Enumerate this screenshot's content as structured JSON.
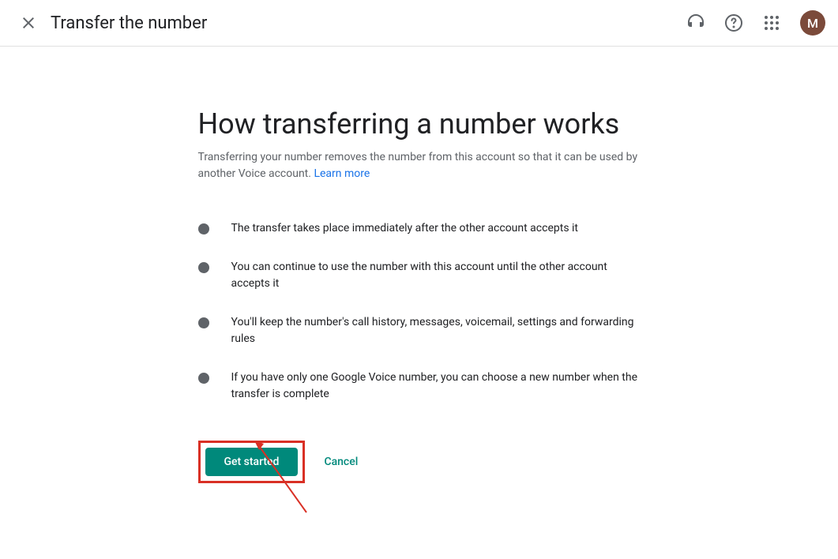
{
  "header": {
    "title": "Transfer the number",
    "avatar_letter": "M"
  },
  "main": {
    "heading": "How transferring a number works",
    "description": "Transferring your number removes the number from this account so that it can be used by another Voice account. ",
    "learn_more": "Learn more",
    "bullets": [
      "The transfer takes place immediately after the other account accepts it",
      "You can continue to use the number with this account until the other account accepts it",
      "You'll keep the number's call history, messages, voicemail, settings and forwarding rules",
      "If you have only one Google Voice number, you can choose a new number when the transfer is complete"
    ]
  },
  "buttons": {
    "primary": "Get started",
    "cancel": "Cancel"
  }
}
